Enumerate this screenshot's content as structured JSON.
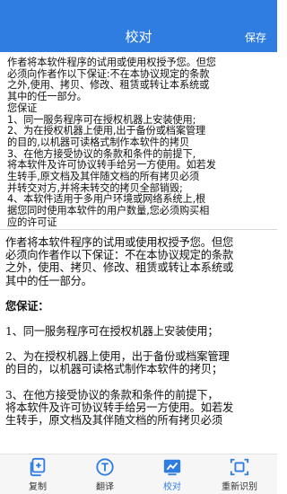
{
  "header": {
    "title": "校对",
    "save_label": "保存"
  },
  "editor": {
    "lines": [
      "作者将本软件程序的试用或使用权授予您。但您",
      "必须向作者作以下保证:不在本协议规定的条款",
      "之外,使用、拷贝、修改、租赁或转让本系统或",
      "其中的任一部分。",
      "您保证",
      "1、同一服务程序可在授权机器上安装使用;",
      "2、为在授权机器上使用,出于备份或档案管理",
      "的目的,以机器可读格式制作本软件的拷贝",
      "3、在他方接受协议的条款和条件的前提下,",
      "将本软件及许可协议转手给另一方使用。如若发",
      "生转手,原文档及其伴随文档的所有拷贝必须",
      "并转交对方,并将未转交的拷贝全部销毁;",
      "4、本软件适用于多用户环境或网络系统上,根",
      "据您同时使用本软件的用户数量,您必须购买相",
      "应的许可证"
    ]
  },
  "result": {
    "para1": [
      "作者将本软件程序的试用或使用权授予您。但您",
      "必须向作者作以下保证：不在本协议规定的条款",
      "之外，使用、拷贝、修改、租赁或转让本系统或",
      "其中的任一部分。"
    ],
    "heading": "您保证：",
    "item1": "1、同一服务程序可在授权机器上安装使用；",
    "item2": [
      "2、为在授权机器上使用，出于备份或档案管理",
      "的目的，以机器可读格式制作本软件的拷贝；"
    ],
    "item3": [
      "3、在他方接受协议的条款和条件的前提下，",
      "将本软件及许可协议转手给另一方使用。如若发",
      "生转手，原文档及其伴随文档的所有拷贝必须"
    ]
  },
  "toolbar": {
    "items": [
      {
        "label": "复制",
        "icon": "copy-icon"
      },
      {
        "label": "翻译",
        "icon": "translate-icon"
      },
      {
        "label": "校对",
        "icon": "proofread-icon"
      },
      {
        "label": "重新识别",
        "icon": "rescan-icon"
      }
    ],
    "active_index": 2
  },
  "colors": {
    "accent": "#2f7de1",
    "toolbar_bg": "#f6f6f6"
  }
}
